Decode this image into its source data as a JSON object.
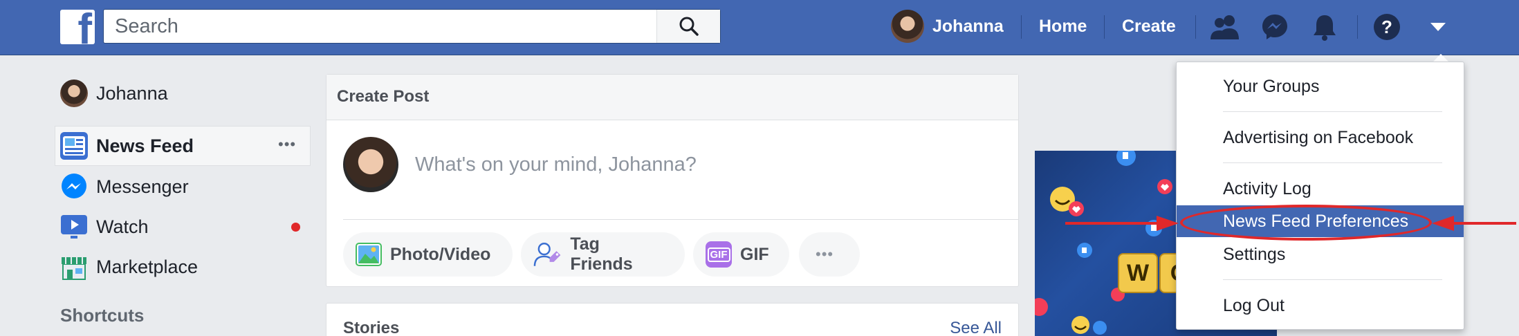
{
  "topbar": {
    "logo_letter": "f",
    "search_placeholder": "Search",
    "user_name": "Johanna",
    "home_label": "Home",
    "create_label": "Create",
    "icons": [
      "friends-icon",
      "messenger-icon",
      "notifications-icon",
      "help-icon",
      "account-menu-caret-icon"
    ]
  },
  "sidebar": {
    "profile_name": "Johanna",
    "items": [
      {
        "label": "News Feed",
        "icon": "news-feed-icon"
      },
      {
        "label": "Messenger",
        "icon": "messenger-icon"
      },
      {
        "label": "Watch",
        "icon": "watch-icon"
      },
      {
        "label": "Marketplace",
        "icon": "marketplace-icon"
      }
    ],
    "more_glyph": "•••",
    "shortcuts_heading": "Shortcuts"
  },
  "create_post": {
    "title": "Create Post",
    "placeholder": "What's on your mind, Johanna?",
    "actions": [
      {
        "label": "Photo/Video",
        "icon": "photo-icon"
      },
      {
        "label": "Tag Friends",
        "icon": "tag-friends-icon"
      },
      {
        "label": "GIF",
        "icon": "gif-icon"
      },
      {
        "label": "•••",
        "icon": "more-icon"
      }
    ],
    "gif_badge": "GIF"
  },
  "stories": {
    "title": "Stories",
    "see_all": "See All"
  },
  "ad": {
    "tile_letters": [
      "W",
      "O"
    ]
  },
  "account_menu": {
    "items": [
      {
        "label": "Your Groups",
        "active": false
      },
      {
        "label": "Advertising on Facebook",
        "active": false
      },
      {
        "label": "Activity Log",
        "active": false
      },
      {
        "label": "News Feed Preferences",
        "active": true
      },
      {
        "label": "Settings",
        "active": false
      },
      {
        "label": "Log Out",
        "active": false
      }
    ]
  },
  "colors": {
    "brand_blue": "#4267b2",
    "link_blue": "#385898",
    "annotation_red": "#e0282a",
    "notification_dot": "#e0282a"
  }
}
